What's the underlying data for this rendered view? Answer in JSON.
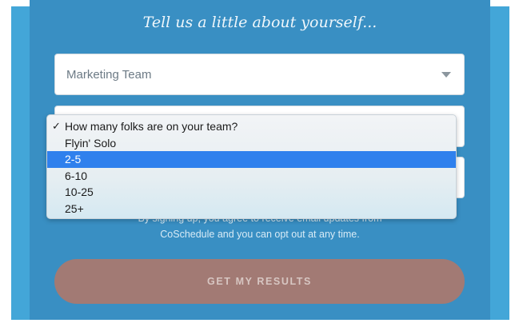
{
  "form": {
    "heading": "Tell us a little about yourself...",
    "role_select": {
      "value": "Marketing Team"
    },
    "legal_text": "By signing up, you agree to receive email updates from",
    "legal_text_2": "CoSchedule and you can opt out at any time.",
    "submit_label": "GET MY RESULTS"
  },
  "team_size_dropdown": {
    "check_mark": "✓",
    "options": [
      {
        "label": "How many folks are on your team?",
        "checked": true
      },
      {
        "label": "Flyin' Solo"
      },
      {
        "label": "2-5",
        "highlighted": true
      },
      {
        "label": "6-10"
      },
      {
        "label": "10-25"
      },
      {
        "label": "25+"
      }
    ]
  },
  "colors": {
    "panel": "#398fc3",
    "backdrop": "#43a6d8",
    "cta": "#a27a74",
    "highlight": "#2f80ed"
  }
}
